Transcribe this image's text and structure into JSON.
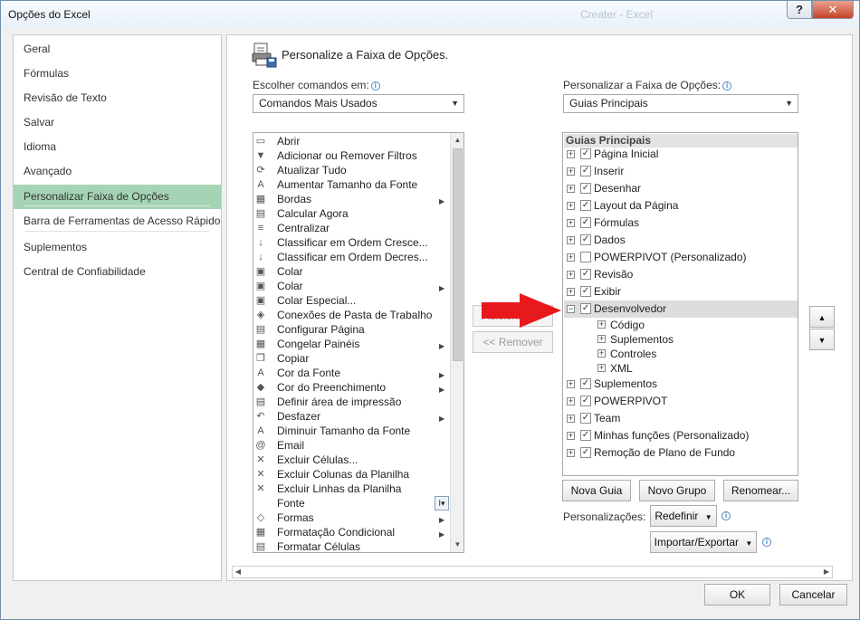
{
  "window": {
    "title": "Opções do Excel",
    "ghost_text": "Creater - Excel",
    "help_label": "?",
    "close_label": "✕"
  },
  "nav": {
    "items": [
      {
        "label": "Geral"
      },
      {
        "label": "Fórmulas"
      },
      {
        "label": "Revisão de Texto"
      },
      {
        "label": "Salvar"
      },
      {
        "label": "Idioma"
      },
      {
        "label": "Avançado"
      },
      {
        "label": "Personalizar Faixa de Opções",
        "selected": true
      },
      {
        "label": "Barra de Ferramentas de Acesso Rápido"
      },
      {
        "label": "Suplementos"
      },
      {
        "label": "Central de Confiabilidade"
      }
    ]
  },
  "heading": "Personalize a Faixa de Opções.",
  "left": {
    "choose_label": "Escolher comandos em:",
    "choose_value": "Comandos Mais Usados",
    "commands": [
      {
        "label": "Abrir",
        "icon": "folder-icon",
        "glyph": "▭"
      },
      {
        "label": "Adicionar ou Remover Filtros",
        "icon": "filter-icon",
        "glyph": "▼"
      },
      {
        "label": "Atualizar Tudo",
        "icon": "refresh-icon",
        "glyph": "⟳"
      },
      {
        "label": "Aumentar Tamanho da Fonte",
        "icon": "font-grow-icon",
        "glyph": "A"
      },
      {
        "label": "Bordas",
        "icon": "borders-icon",
        "glyph": "▦",
        "sub": true
      },
      {
        "label": "Calcular Agora",
        "icon": "calculator-icon",
        "glyph": "▤"
      },
      {
        "label": "Centralizar",
        "icon": "align-center-icon",
        "glyph": "≡"
      },
      {
        "label": "Classificar em Ordem Cresce...",
        "icon": "sort-asc-icon",
        "glyph": "↓"
      },
      {
        "label": "Classificar em Ordem Decres...",
        "icon": "sort-desc-icon",
        "glyph": "↓"
      },
      {
        "label": "Colar",
        "icon": "paste-icon",
        "glyph": "▣"
      },
      {
        "label": "Colar",
        "icon": "paste-icon",
        "glyph": "▣",
        "sub": true
      },
      {
        "label": "Colar Especial...",
        "icon": "paste-special-icon",
        "glyph": "▣"
      },
      {
        "label": "Conexões de Pasta de Trabalho",
        "icon": "connections-icon",
        "glyph": "◈"
      },
      {
        "label": "Configurar Página",
        "icon": "page-setup-icon",
        "glyph": "▤"
      },
      {
        "label": "Congelar Painéis",
        "icon": "freeze-panes-icon",
        "glyph": "▦",
        "sub": true
      },
      {
        "label": "Copiar",
        "icon": "copy-icon",
        "glyph": "❐"
      },
      {
        "label": "Cor da Fonte",
        "icon": "font-color-icon",
        "glyph": "A",
        "sub": true
      },
      {
        "label": "Cor do Preenchimento",
        "icon": "fill-color-icon",
        "glyph": "◆",
        "sub": true
      },
      {
        "label": "Definir área de impressão",
        "icon": "print-area-icon",
        "glyph": "▤"
      },
      {
        "label": "Desfazer",
        "icon": "undo-icon",
        "glyph": "↶",
        "sub": true
      },
      {
        "label": "Diminuir Tamanho da Fonte",
        "icon": "font-shrink-icon",
        "glyph": "A"
      },
      {
        "label": "Email",
        "icon": "email-icon",
        "glyph": "@"
      },
      {
        "label": "Excluir Células...",
        "icon": "delete-cells-icon",
        "glyph": "✕"
      },
      {
        "label": "Excluir Colunas da Planilha",
        "icon": "delete-columns-icon",
        "glyph": "✕"
      },
      {
        "label": "Excluir Linhas da Planilha",
        "icon": "delete-rows-icon",
        "glyph": "✕"
      },
      {
        "label": "Fonte",
        "icon": "font-icon",
        "glyph": "",
        "font_sub": true
      },
      {
        "label": "Formas",
        "icon": "shapes-icon",
        "glyph": "◇",
        "sub": true
      },
      {
        "label": "Formatação Condicional",
        "icon": "conditional-format-icon",
        "glyph": "▦",
        "sub": true
      },
      {
        "label": "Formatar Células",
        "icon": "format-cells-icon",
        "glyph": "▤"
      }
    ]
  },
  "middle": {
    "add_label": "Adicionar >>",
    "remove_label": "<< Remover"
  },
  "right": {
    "customize_label": "Personalizar a Faixa de Opções:",
    "customize_value": "Guias Principais",
    "tree_header": "Guias Principais",
    "tabs_top": [
      {
        "label": "Página Inicial",
        "checked": true
      },
      {
        "label": "Inserir",
        "checked": true
      },
      {
        "label": "Desenhar",
        "checked": true
      },
      {
        "label": "Layout da Página",
        "checked": true
      },
      {
        "label": "Fórmulas",
        "checked": true
      },
      {
        "label": "Dados",
        "checked": true
      },
      {
        "label": "POWERPIVOT (Personalizado)",
        "checked": false
      },
      {
        "label": "Revisão",
        "checked": true
      },
      {
        "label": "Exibir",
        "checked": true
      }
    ],
    "developer": {
      "label": "Desenvolvedor",
      "checked": true,
      "expanded": true
    },
    "developer_groups": [
      {
        "label": "Código"
      },
      {
        "label": "Suplementos"
      },
      {
        "label": "Controles"
      },
      {
        "label": "XML"
      }
    ],
    "tabs_bottom": [
      {
        "label": "Suplementos",
        "checked": true
      },
      {
        "label": "POWERPIVOT",
        "checked": true
      },
      {
        "label": "Team",
        "checked": true
      },
      {
        "label": "Minhas funções (Personalizado)",
        "checked": true
      },
      {
        "label": "Remoção de Plano de Fundo",
        "checked": true
      }
    ],
    "new_tab_label": "Nova Guia",
    "new_group_label": "Novo Grupo",
    "rename_label": "Renomear...",
    "customizations_label": "Personalizações:",
    "reset_label": "Redefinir",
    "import_export_label": "Importar/Exportar"
  },
  "footer": {
    "ok_label": "OK",
    "cancel_label": "Cancelar"
  },
  "colors": {
    "selected_nav": "#a4d4b4",
    "arrow": "#e8191c"
  }
}
